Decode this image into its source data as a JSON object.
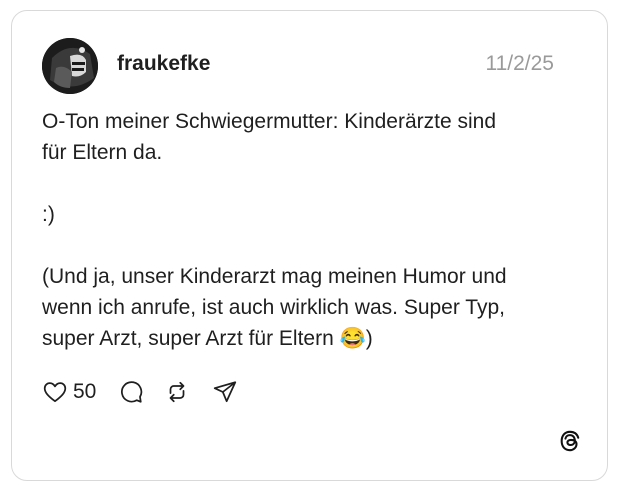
{
  "post": {
    "username": "fraukefke",
    "date": "11/2/25",
    "lines": {
      "l1": "O-Ton meiner Schwiegermutter: Kinderärzte sind",
      "l2": "für Eltern da.",
      "l3": ":)",
      "l4": "(Und ja, unser Kinderarzt mag meinen Humor und",
      "l5": "wenn ich anrufe, ist auch wirklich was. Super Typ,",
      "l6": "super Arzt, super Arzt für Eltern 😂)"
    },
    "actions": {
      "like_count": "50",
      "like_icon": "heart-icon",
      "comment_icon": "comment-icon",
      "repost_icon": "repost-icon",
      "share_icon": "send-icon"
    }
  },
  "brand": {
    "logo_icon": "threads-logo-icon"
  }
}
